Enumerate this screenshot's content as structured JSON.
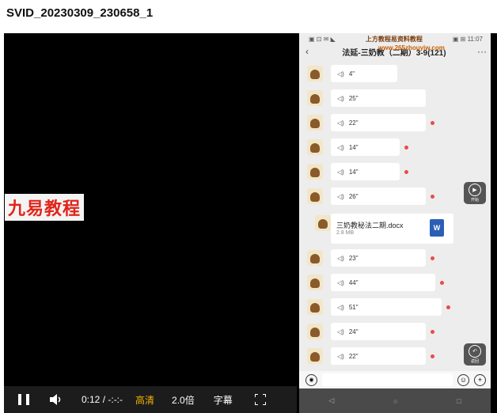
{
  "window": {
    "title": "SVID_20230309_230658_1"
  },
  "video": {
    "watermark": "九易教程",
    "phone": {
      "status_left": "▣ ⊡ ✉ ◣",
      "status_site": "上方教程易资料教程",
      "status_right": "▣ ⊞ 11:07",
      "site_watermark": "www.265zhouyiw.com",
      "chat_title": "法延-三奶教（二期）3-9(121)",
      "messages": [
        {
          "duration": "4\"",
          "unread": false,
          "width": 84
        },
        {
          "duration": "25\"",
          "unread": false,
          "width": 120
        },
        {
          "duration": "22\"",
          "unread": true,
          "width": 120
        },
        {
          "duration": "14\"",
          "unread": true,
          "width": 87
        },
        {
          "duration": "14\"",
          "unread": true,
          "width": 87
        },
        {
          "duration": "26\"",
          "unread": true,
          "width": 120
        }
      ],
      "file": {
        "name": "三奶教秘法二期.docx",
        "size": "2.8 MB",
        "icon_letter": "W"
      },
      "messages_after": [
        {
          "duration": "23\"",
          "unread": true,
          "width": 120
        },
        {
          "duration": "44\"",
          "unread": true,
          "width": 132
        },
        {
          "duration": "51\"",
          "unread": true,
          "width": 140
        },
        {
          "duration": "24\"",
          "unread": true,
          "width": 120
        },
        {
          "duration": "22\"",
          "unread": true,
          "width": 120
        }
      ],
      "fab_top_label": "开始",
      "fab_bottom_label": "返回"
    }
  },
  "controls": {
    "time": "0:12 / -:-:-",
    "quality": "高清",
    "speed": "2.0倍",
    "subtitles": "字幕"
  }
}
